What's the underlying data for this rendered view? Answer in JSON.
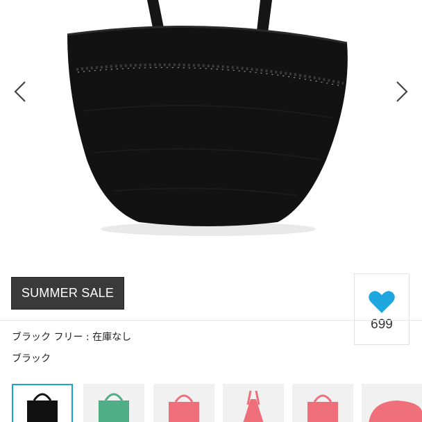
{
  "product": {
    "badge": "SUMMER SALE",
    "favorite_count": "699",
    "stock_status": "ブラック  フリー : 在庫なし",
    "selected_color": "ブラック"
  },
  "colors": {
    "heart": "#1ea7df",
    "badge_bg": "#3a3a3a",
    "thumb_selected_border": "#19a6c9"
  },
  "gallery": {
    "thumbnails": [
      {
        "name": "black-tote",
        "color": "#111111",
        "selected": true
      },
      {
        "name": "green-tote",
        "color": "#4fae86",
        "selected": false
      },
      {
        "name": "pink-tote",
        "color": "#ee6f79",
        "selected": false
      },
      {
        "name": "pink-tote-side",
        "color": "#ee6f79",
        "selected": false
      },
      {
        "name": "pink-tote-front",
        "color": "#ee6f79",
        "selected": false
      },
      {
        "name": "pink-hat",
        "color": "#ef6f7b",
        "selected": false
      }
    ]
  }
}
